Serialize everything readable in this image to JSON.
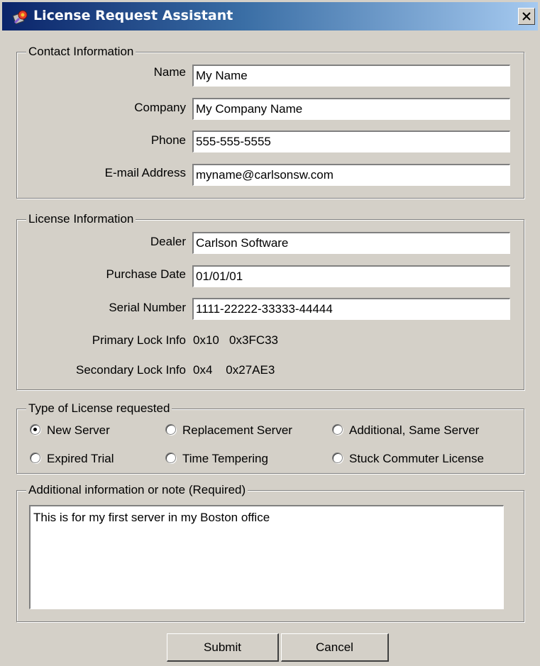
{
  "window": {
    "title": "License Request Assistant",
    "close_icon": "close-icon",
    "app_icon": "license-app-icon"
  },
  "contact": {
    "legend": "Contact Information",
    "name_label": "Name",
    "name_value": "My Name",
    "company_label": "Company",
    "company_value": "My Company Name",
    "phone_label": "Phone",
    "phone_value": "555-555-5555",
    "email_label": "E-mail Address",
    "email_value": "myname@carlsonsw.com"
  },
  "license": {
    "legend": "License Information",
    "dealer_label": "Dealer",
    "dealer_value": "Carlson Software",
    "purchase_label": "Purchase Date",
    "purchase_value": "01/01/01",
    "serial_label": "Serial Number",
    "serial_value": "1111-22222-33333-44444",
    "primary_label": "Primary Lock Info",
    "primary_value": "0x10   0x3FC33",
    "secondary_label": "Secondary Lock Info",
    "secondary_value": "0x4    0x27AE3"
  },
  "license_type": {
    "legend": "Type of License requested",
    "options": [
      {
        "label": "New Server",
        "selected": true
      },
      {
        "label": "Replacement Server",
        "selected": false
      },
      {
        "label": "Additional, Same Server",
        "selected": false
      },
      {
        "label": "Expired Trial",
        "selected": false
      },
      {
        "label": "Time Tempering",
        "selected": false
      },
      {
        "label": "Stuck Commuter License",
        "selected": false
      }
    ]
  },
  "notes": {
    "legend": "Additional information or note (Required)",
    "value": "This is for my first server in my Boston office"
  },
  "buttons": {
    "submit": "Submit",
    "cancel": "Cancel"
  }
}
